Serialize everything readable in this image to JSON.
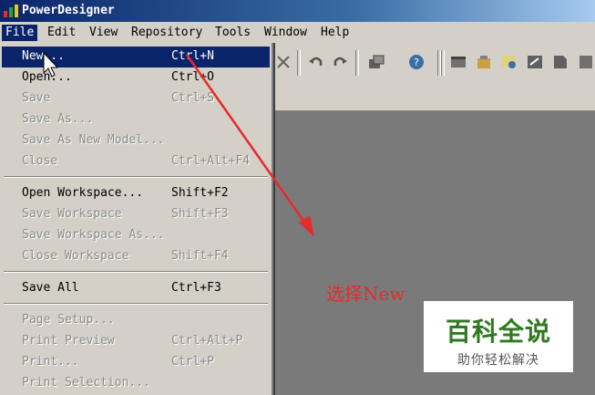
{
  "window": {
    "title": "PowerDesigner"
  },
  "menubar": [
    "File",
    "Edit",
    "View",
    "Repository",
    "Tools",
    "Window",
    "Help"
  ],
  "file_menu": [
    {
      "label": "New...",
      "shortcut": "Ctrl+N",
      "state": "highlighted"
    },
    {
      "label": "Open...",
      "shortcut": "Ctrl+O",
      "state": "enabled"
    },
    {
      "label": "Save",
      "shortcut": "Ctrl+S",
      "state": "disabled"
    },
    {
      "label": "Save As...",
      "shortcut": "",
      "state": "disabled"
    },
    {
      "label": "Save As New Model...",
      "shortcut": "",
      "state": "disabled"
    },
    {
      "label": "Close",
      "shortcut": "Ctrl+Alt+F4",
      "state": "disabled"
    },
    {
      "label": "Open Workspace...",
      "shortcut": "Shift+F2",
      "state": "enabled"
    },
    {
      "label": "Save Workspace",
      "shortcut": "Shift+F3",
      "state": "disabled"
    },
    {
      "label": "Save Workspace As...",
      "shortcut": "",
      "state": "disabled"
    },
    {
      "label": "Close Workspace",
      "shortcut": "Shift+F4",
      "state": "disabled"
    },
    {
      "label": "Save All",
      "shortcut": "Ctrl+F3",
      "state": "enabled"
    },
    {
      "label": "Page Setup...",
      "shortcut": "",
      "state": "disabled"
    },
    {
      "label": "Print Preview",
      "shortcut": "Ctrl+Alt+P",
      "state": "disabled"
    },
    {
      "label": "Print...",
      "shortcut": "Ctrl+P",
      "state": "disabled"
    },
    {
      "label": "Print Selection...",
      "shortcut": "",
      "state": "disabled"
    }
  ],
  "annotation": "选择New",
  "watermark": {
    "title": "百科全说",
    "subtitle": "助你轻松解决"
  },
  "toolbar_icons": [
    "delete-icon",
    "undo-icon",
    "redo-icon",
    "properties-icon",
    "help-icon",
    "model-icon",
    "package-icon",
    "browser-icon",
    "output-icon",
    "result-icon"
  ],
  "colors": {
    "highlight": "#0a246a",
    "annotation": "#e52b2b",
    "watermark": "#2f7a1f"
  }
}
